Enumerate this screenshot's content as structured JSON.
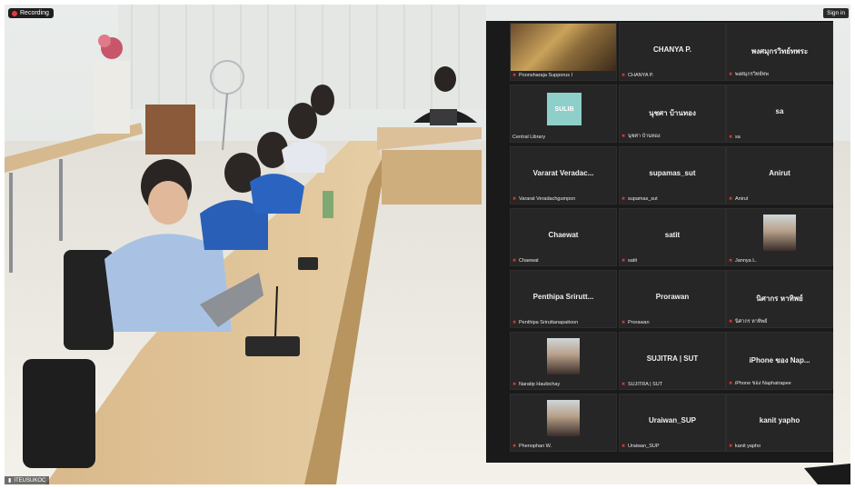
{
  "recording_label": "Recording",
  "sign_in_label": "Sign in",
  "host_label": "ITEUSUKOC",
  "tiles": [
    {
      "name": "",
      "label": "Poonsharaja Supporus I",
      "has_video": true
    },
    {
      "name": "CHANYA P.",
      "label": "CHANYA P."
    },
    {
      "name": "พงศมุกรวิทย์ทพระ",
      "label": "พงศมุกรวิทย์ทพ"
    },
    {
      "name": "",
      "label": "Central Library",
      "has_logo": true,
      "logo_text": "SULIB"
    },
    {
      "name": "นุชศา บ้านทอง",
      "label": "นุชศา บ้านทอง"
    },
    {
      "name": "sa",
      "label": "sa"
    },
    {
      "name": "Vararat Veradac...",
      "label": "Vararat Veradachgumpon"
    },
    {
      "name": "supamas_sut",
      "label": "supamas_sut"
    },
    {
      "name": "Anirut",
      "label": "Anirut"
    },
    {
      "name": "Chaewat",
      "label": "Chaewat"
    },
    {
      "name": "satit",
      "label": "satit"
    },
    {
      "name": "",
      "label": "Jannya L.",
      "has_photo": true
    },
    {
      "name": "Penthipa Srirutt...",
      "label": "Penthipa Sriruttanapaitoon"
    },
    {
      "name": "Prorawan",
      "label": "Prorawan"
    },
    {
      "name": "นิศากร หาทิพย์",
      "label": "นิศากร หาทิพย์"
    },
    {
      "name": "",
      "label": "Naratip Haubichay",
      "has_photo": true
    },
    {
      "name": "SUJITRA | SUT",
      "label": "SUJITRA | SUT"
    },
    {
      "name": "iPhone ของ Nap...",
      "label": "iPhone ของ Naphatrapee"
    },
    {
      "name": "",
      "label": "Phenophan W.",
      "has_photo": true
    },
    {
      "name": "Uraiwan_SUP",
      "label": "Uraiwan_SUP"
    },
    {
      "name": "kanit yapho",
      "label": "kanit yapho"
    }
  ]
}
